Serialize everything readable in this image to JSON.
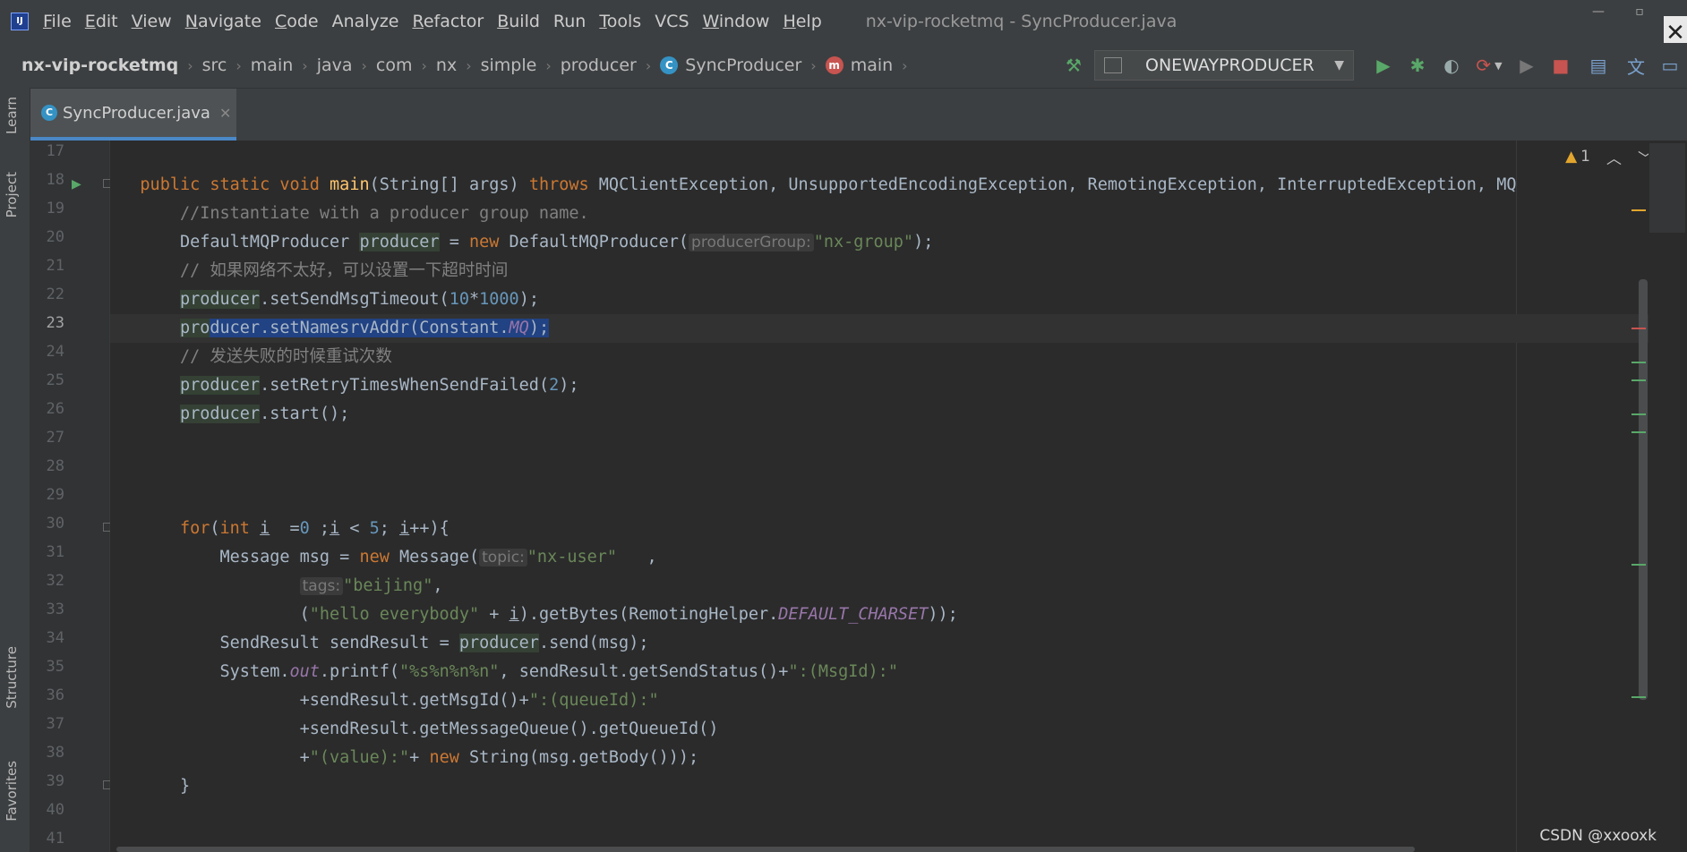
{
  "menubar": {
    "items": [
      {
        "u": "F",
        "rest": "ile"
      },
      {
        "u": "E",
        "rest": "dit"
      },
      {
        "u": "V",
        "rest": "iew"
      },
      {
        "u": "N",
        "rest": "avigate"
      },
      {
        "u": "C",
        "rest": "ode"
      },
      {
        "u": "",
        "rest": "Analyze"
      },
      {
        "u": "R",
        "rest": "efactor"
      },
      {
        "u": "B",
        "rest": "uild"
      },
      {
        "u": "",
        "rest": "Run"
      },
      {
        "u": "T",
        "rest": "ools"
      },
      {
        "u": "",
        "rest": "VCS"
      },
      {
        "u": "W",
        "rest": "indow"
      },
      {
        "u": "H",
        "rest": "elp"
      }
    ],
    "window_title": "nx-vip-rocketmq - SyncProducer.java",
    "min": "—",
    "max": "▫",
    "close": "✕"
  },
  "breadcrumb": {
    "items": [
      "nx-vip-rocketmq",
      "src",
      "main",
      "java",
      "com",
      "nx",
      "simple",
      "producer",
      "SyncProducer",
      "main"
    ]
  },
  "toolbar": {
    "run_config": "ONEWAYPRODUCER"
  },
  "tab": {
    "label": "SyncProducer.java",
    "close": "✕"
  },
  "sidebar": {
    "learn": "Learn",
    "project": "Project",
    "structure": "Structure",
    "favorites": "Favorites"
  },
  "warnings": {
    "count": "1"
  },
  "code": {
    "line_numbers": [
      "17",
      "18",
      "19",
      "20",
      "21",
      "22",
      "23",
      "24",
      "25",
      "26",
      "27",
      "28",
      "29",
      "30",
      "31",
      "32",
      "33",
      "34",
      "35",
      "36",
      "37",
      "38",
      "39",
      "40",
      "41"
    ],
    "l18": {
      "a": "public static void ",
      "fn": "main",
      "b": "(String[] args) ",
      "kw": "throws",
      "c": " MQClientException, UnsupportedEncodingException, RemotingException, InterruptedException, MQ"
    },
    "l19": "//Instantiate with a producer group name.",
    "l20": {
      "a": "DefaultMQProducer ",
      "ref": "producer",
      "b": " = ",
      "kw": "new",
      "c": " DefaultMQProducer(",
      "hint": "producerGroup:",
      "str": "\"nx-group\"",
      "d": ");"
    },
    "l21": "// 如果网络不太好，可以设置一下超时时间",
    "l22": {
      "ref": "producer",
      "a": ".setSendMsgTimeout(",
      "num": "10",
      "b": "*",
      "num2": "1000",
      "c": ");"
    },
    "l23": {
      "a": "pro",
      "sel": "ducer.setNamesrvAddr(Constant.",
      "ital": "MQ",
      "sel2": ");"
    },
    "l24": "// 发送失败的时候重试次数",
    "l25": {
      "ref": "producer",
      "a": ".setRetryTimesWhenSendFailed(",
      "num": "2",
      "b": ");"
    },
    "l26": {
      "ref": "producer",
      "a": ".start();"
    },
    "l30": {
      "kw": "for",
      "a": "(",
      "kw2": "int",
      "b": " ",
      "v": "i",
      "c": "  =",
      "num": "0",
      "d": " ;",
      "v2": "i",
      "e": " < ",
      "num2": "5",
      "f": "; ",
      "v3": "i",
      "g": "++){"
    },
    "l31": {
      "a": "Message msg = ",
      "kw": "new",
      "b": " Message(",
      "hint": "topic:",
      "str": "\"nx-user\"",
      "c": "   ,"
    },
    "l32": {
      "hint": "tags:",
      "str": "\"beijing\"",
      "a": ","
    },
    "l33": {
      "a": "(",
      "str": "\"hello everybody\"",
      "b": " + ",
      "v": "i",
      "c": ").getBytes(RemotingHelper.",
      "ital": "DEFAULT_CHARSET",
      "d": "));"
    },
    "l34": {
      "a": "SendResult sendResult = ",
      "ref": "producer",
      "b": ".send(msg);"
    },
    "l35": {
      "a": "System.",
      "ital": "out",
      "b": ".printf(",
      "str": "\"%s%n%n%n\"",
      "c": ", sendResult.getSendStatus()+",
      "str2": "\":(MsgId):\""
    },
    "l36": {
      "a": "+sendResult.getMsgId()+",
      "str": "\":(queueId):\""
    },
    "l37": "+sendResult.getMessageQueue().getQueueId()",
    "l38": {
      "a": "+",
      "str": "\"(value):\"",
      "b": "+ ",
      "kw": "new",
      "c": " String(msg.getBody()));"
    },
    "l39": "}"
  },
  "watermark": "CSDN @xxooxk"
}
